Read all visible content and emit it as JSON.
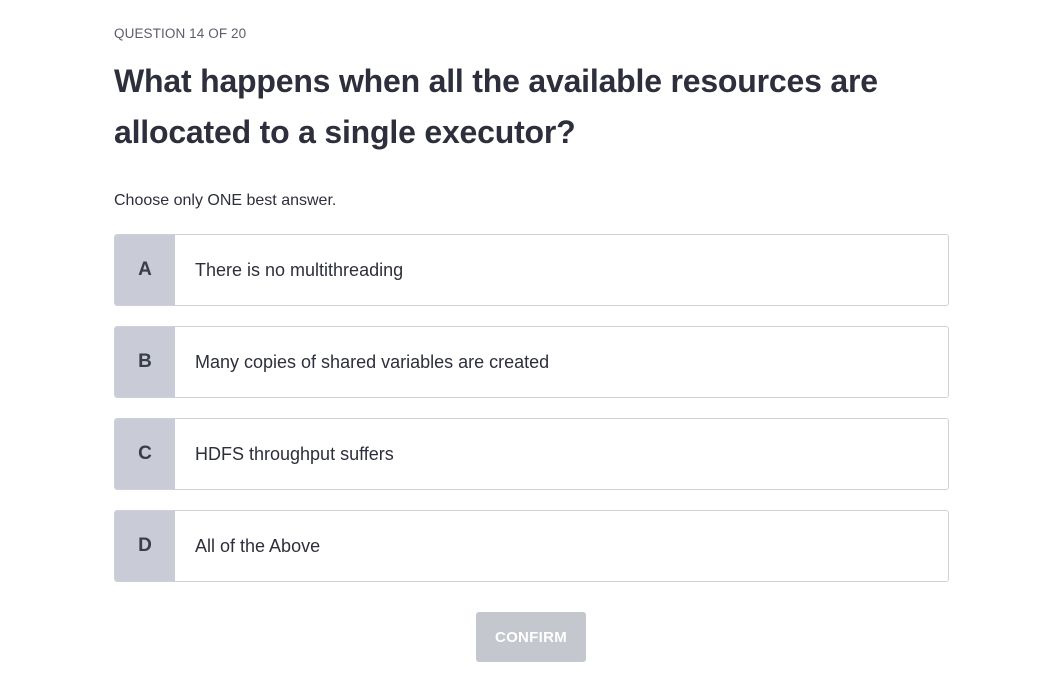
{
  "quiz": {
    "progress_label": "QUESTION 14 OF 20",
    "question_text": "What happens when all the available resources are allocated to a single executor?",
    "instruction": "Choose only ONE best answer.",
    "options": [
      {
        "letter": "A",
        "text": "There is no multithreading"
      },
      {
        "letter": "B",
        "text": "Many copies of shared variables are created"
      },
      {
        "letter": "C",
        "text": "HDFS throughput suffers"
      },
      {
        "letter": "D",
        "text": "All of the Above"
      }
    ],
    "confirm_label": "CONFIRM"
  },
  "colors": {
    "letter_bg": "#c9ccd6",
    "border": "#cfd1d8",
    "confirm_disabled_bg": "#c5c7ce",
    "text": "#2d2f3c"
  }
}
